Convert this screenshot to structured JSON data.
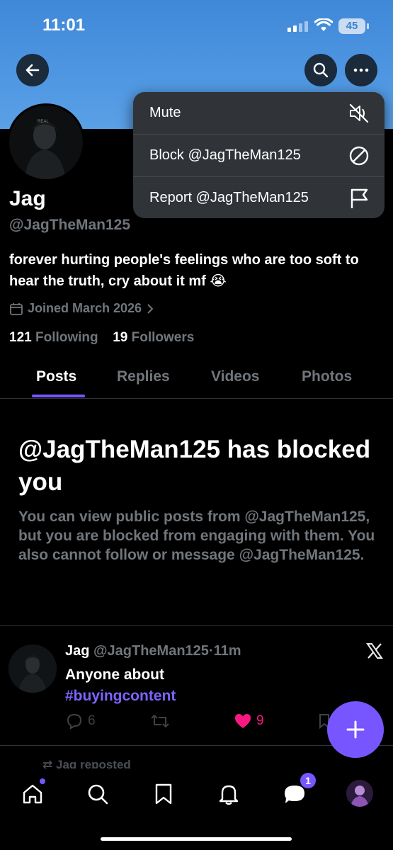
{
  "status_bar": {
    "time": "11:01",
    "battery": "45"
  },
  "profile": {
    "name": "Jag",
    "handle": "@JagTheMan125",
    "avatar_text": "REAL",
    "bio": "forever hurting people's feelings who are too soft to hear the truth, cry about it mf 😭",
    "joined": "Joined March 2026",
    "following_count": "121",
    "following_label": "Following",
    "followers_count": "19",
    "followers_label": "Followers"
  },
  "tabs": [
    "Posts",
    "Replies",
    "Videos",
    "Photos"
  ],
  "menu": {
    "mute": "Mute",
    "block": "Block @JagTheMan125",
    "report": "Report @JagTheMan125"
  },
  "blocked": {
    "title": "@JagTheMan125 has blocked you",
    "description": "You can view public posts from @JagTheMan125, but you are blocked from engaging with them. You also cannot follow or message @JagTheMan125."
  },
  "post": {
    "author": "Jag",
    "handle": "@JagTheMan125",
    "separator": "·",
    "time": "11m",
    "text": "Anyone about",
    "hashtag": "#buyingcontent",
    "replies": "6",
    "likes": "9"
  },
  "next_item_label": "Jag reposted",
  "nav": {
    "messages_badge": "1"
  },
  "colors": {
    "accent": "#7856ff",
    "like": "#f91880",
    "banner": "#4a92dd"
  }
}
